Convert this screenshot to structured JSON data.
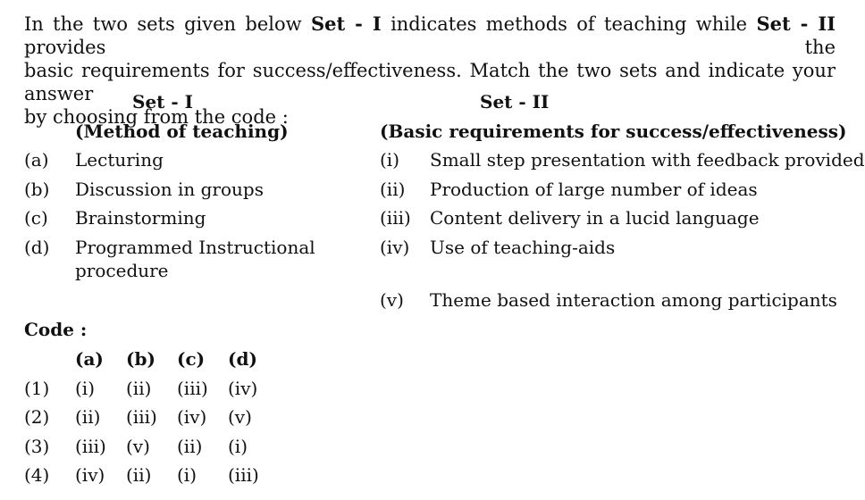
{
  "intro": {
    "line1_a": "In the two sets given below ",
    "line1_b": "Set - I",
    "line1_c": " indicates methods of teaching while ",
    "line1_d": "Set - II",
    "line1_e": " provides the",
    "line2": "basic requirements for success/effectiveness.  Match the two sets and indicate your answer",
    "line3": "by choosing from the code :"
  },
  "set1": {
    "title": "Set - I",
    "subtitle": "(Method of teaching)",
    "items": [
      {
        "label": "(a)",
        "text": "Lecturing"
      },
      {
        "label": "(b)",
        "text": "Discussion in groups"
      },
      {
        "label": "(c)",
        "text": "Brainstorming"
      },
      {
        "label": "(d)",
        "text": "Programmed Instructional",
        "text2": "procedure"
      }
    ]
  },
  "set2": {
    "title": "Set - II",
    "subtitle": "(Basic requirements for success/effectiveness)",
    "items": [
      {
        "label": "(i)",
        "text": "Small step presentation with feedback provided"
      },
      {
        "label": "(ii)",
        "text": "Production of large number of ideas"
      },
      {
        "label": "(iii)",
        "text": "Content delivery in a lucid language"
      },
      {
        "label": "(iv)",
        "text": "Use of teaching-aids"
      },
      {
        "label": "(v)",
        "text": "Theme based interaction among participants"
      }
    ]
  },
  "code": {
    "title": "Code :",
    "headers": [
      "(a)",
      "(b)",
      "(c)",
      "(d)"
    ],
    "rows": [
      {
        "num": "(1)",
        "vals": [
          "(i)",
          "(ii)",
          "(iii)",
          "(iv)"
        ]
      },
      {
        "num": "(2)",
        "vals": [
          "(ii)",
          "(iii)",
          "(iv)",
          "(v)"
        ]
      },
      {
        "num": "(3)",
        "vals": [
          "(iii)",
          "(v)",
          "(ii)",
          "(i)"
        ]
      },
      {
        "num": "(4)",
        "vals": [
          "(iv)",
          "(ii)",
          "(i)",
          "(iii)"
        ]
      }
    ]
  }
}
